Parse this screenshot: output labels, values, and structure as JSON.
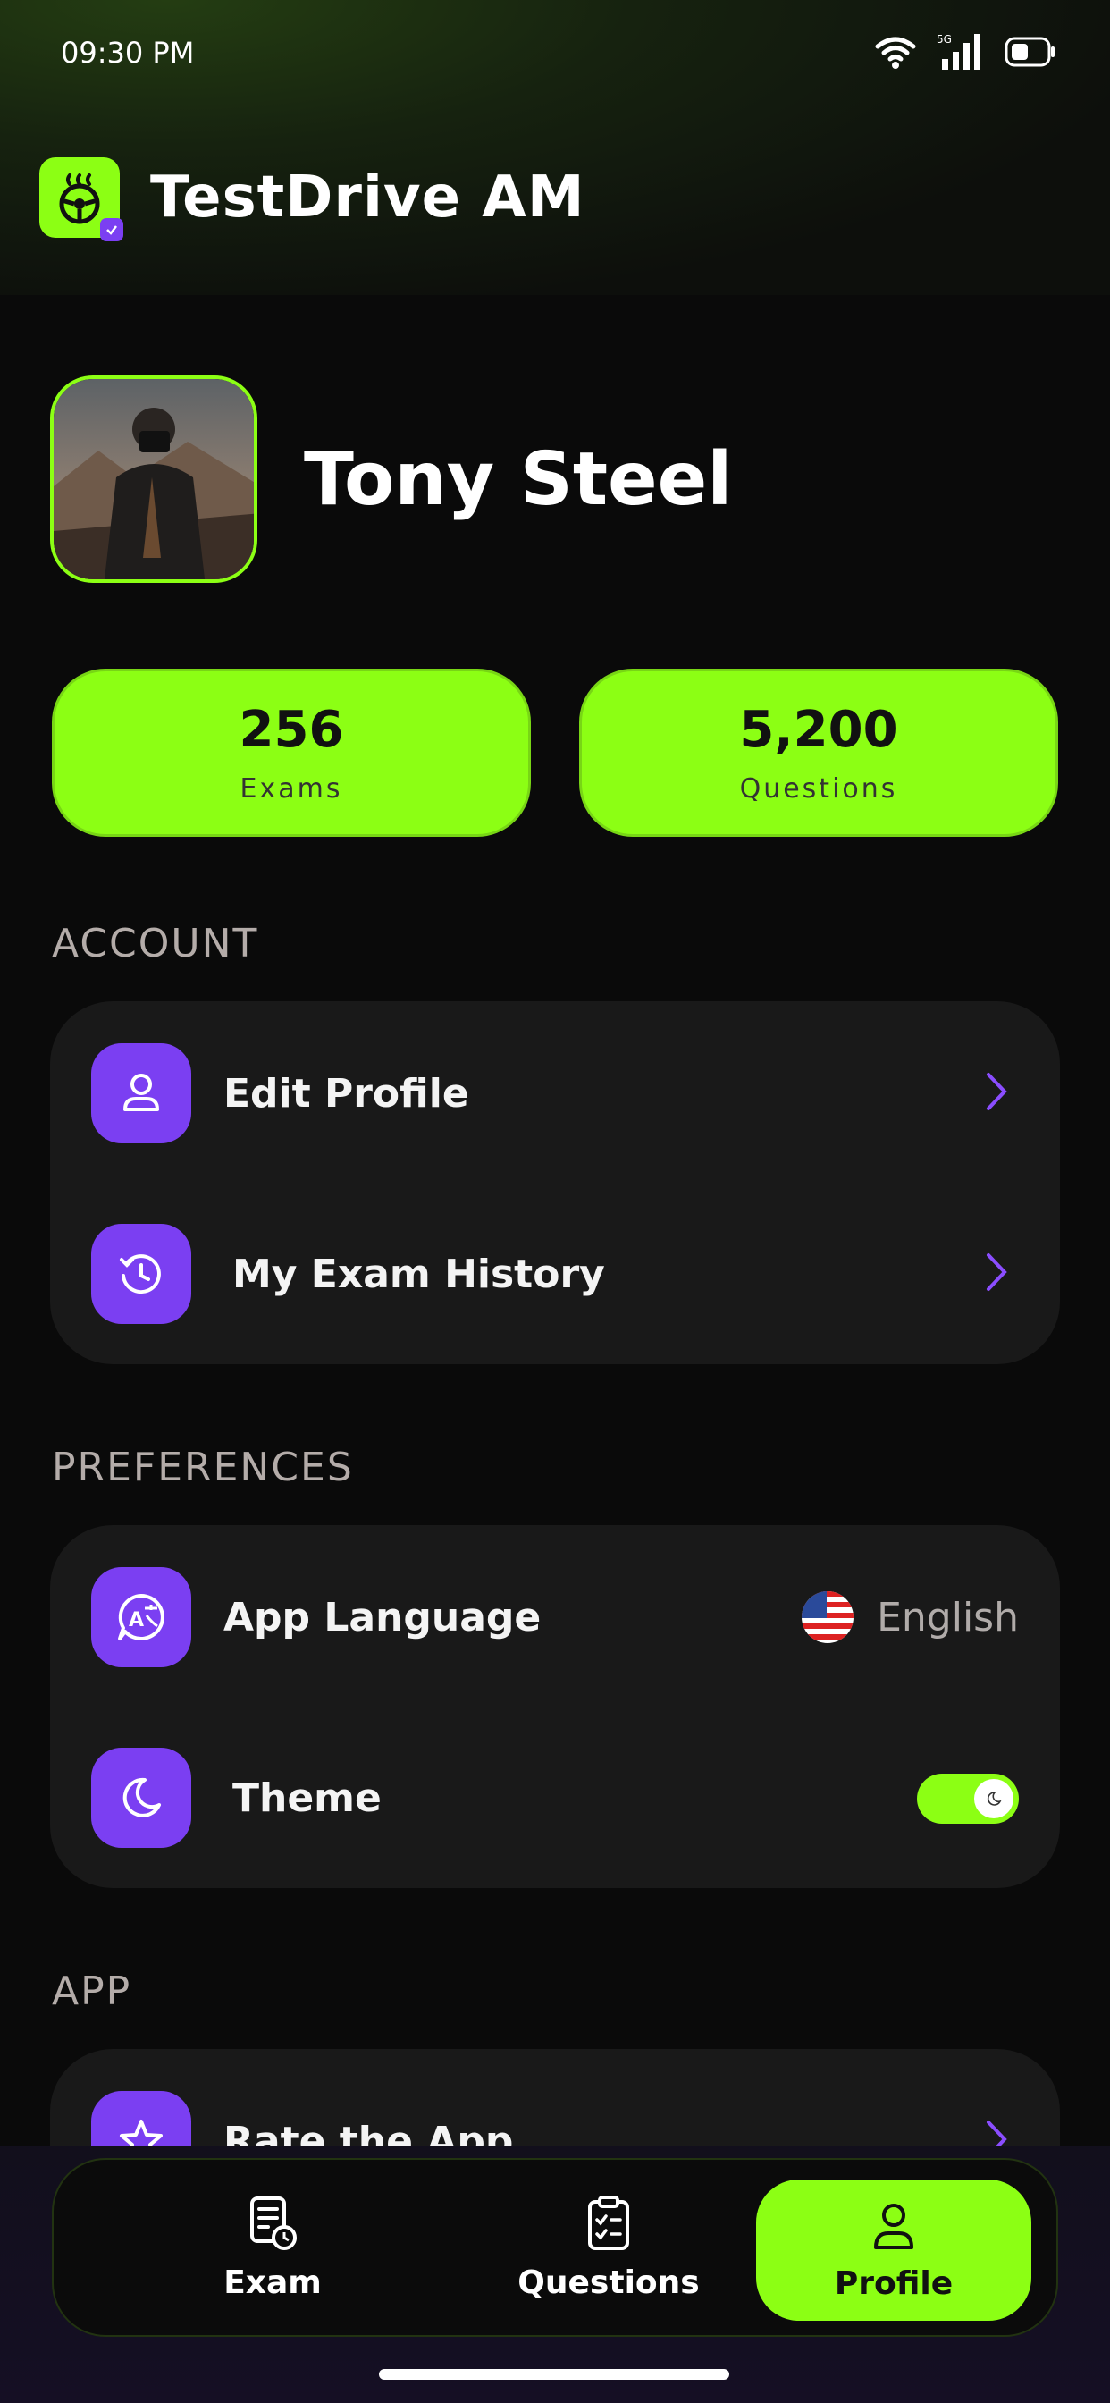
{
  "status_bar": {
    "time": "09:30 PM",
    "network": "5G"
  },
  "app": {
    "title": "TestDrive AM"
  },
  "profile": {
    "name": "Tony Steel"
  },
  "stats": [
    {
      "value": "256",
      "label": "Exams"
    },
    {
      "value": "5,200",
      "label": "Questions"
    }
  ],
  "sections": {
    "account": {
      "title": "ACCOUNT",
      "items": [
        {
          "label": "Edit Profile",
          "icon": "user-icon"
        },
        {
          "label": "My Exam History",
          "icon": "history-icon"
        }
      ]
    },
    "preferences": {
      "title": "PREFERENCES",
      "items": [
        {
          "label": "App Language",
          "icon": "language-icon",
          "value": "English",
          "value_icon": "us-flag-icon"
        },
        {
          "label": "Theme",
          "icon": "moon-icon",
          "toggle_on": true
        }
      ]
    },
    "app": {
      "title": "APP",
      "items": [
        {
          "label": "Rate the App",
          "icon": "star-icon"
        }
      ]
    }
  },
  "tabs": [
    {
      "label": "Exam",
      "icon": "exam-icon",
      "active": false
    },
    {
      "label": "Questions",
      "icon": "clipboard-icon",
      "active": false
    },
    {
      "label": "Profile",
      "icon": "profile-icon",
      "active": true
    }
  ],
  "colors": {
    "accent": "#8cff14",
    "purple": "#7b3ff2",
    "card": "#191919",
    "background": "#0a0a0a"
  }
}
